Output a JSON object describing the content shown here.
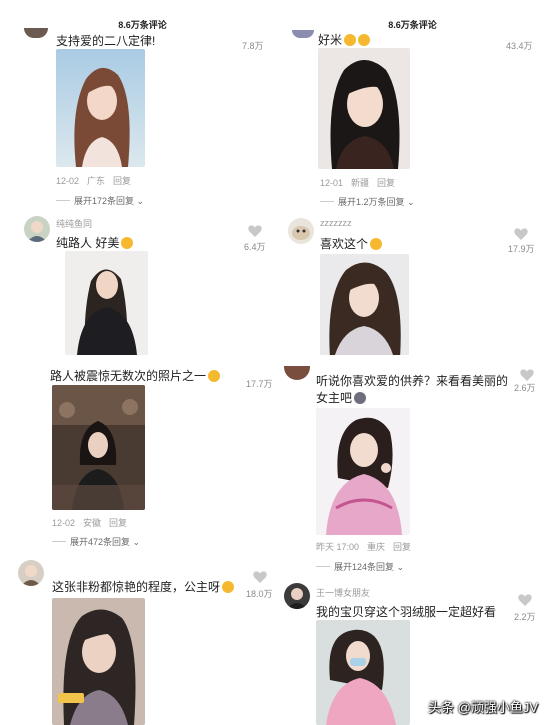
{
  "header": {
    "left_title": "8.6万条评论",
    "right_title": "8.6万条评论"
  },
  "comments": {
    "c1": {
      "text": "支持爱的二八定律!",
      "likes": "7.8万",
      "date": "12-02",
      "location": "广东",
      "reply": "回复",
      "expand": "展开172条回复"
    },
    "c2": {
      "text": "好米",
      "likes": "43.4万",
      "date": "12-01",
      "location": "新疆",
      "reply": "回复",
      "expand": "展开1.2万条回复"
    },
    "c3": {
      "username": "纯纯鱼同",
      "text": "纯路人 好美",
      "likes": "6.4万"
    },
    "c4": {
      "username": "zzzzzzz",
      "text": "喜欢这个",
      "likes": "17.9万"
    },
    "c5": {
      "text": "路人被震惊无数次的照片之一",
      "likes": "17.7万",
      "date": "12-02",
      "location": "安徽",
      "reply": "回复",
      "expand": "展开472条回复"
    },
    "c6": {
      "text_line1": "听说你喜欢爱的供养？来看看美丽的",
      "text_line2": "女主吧",
      "likes": "2.6万",
      "date": "昨天 17:00",
      "location": "重庆",
      "reply": "回复",
      "expand": "展开124条回复"
    },
    "c7": {
      "text": "这张非粉都惊艳的程度，公主呀",
      "likes": "18.0万"
    },
    "c8": {
      "username": "王一博女朋友",
      "text": "我的宝贝穿这个羽绒服一定超好看",
      "likes": "2.2万"
    }
  },
  "watermark": "头条 @顽强小鱼JV",
  "colors": {
    "meta_gray": "#9a9a9a",
    "heart_gray": "#c8c8c8",
    "background": "#ffffff"
  }
}
